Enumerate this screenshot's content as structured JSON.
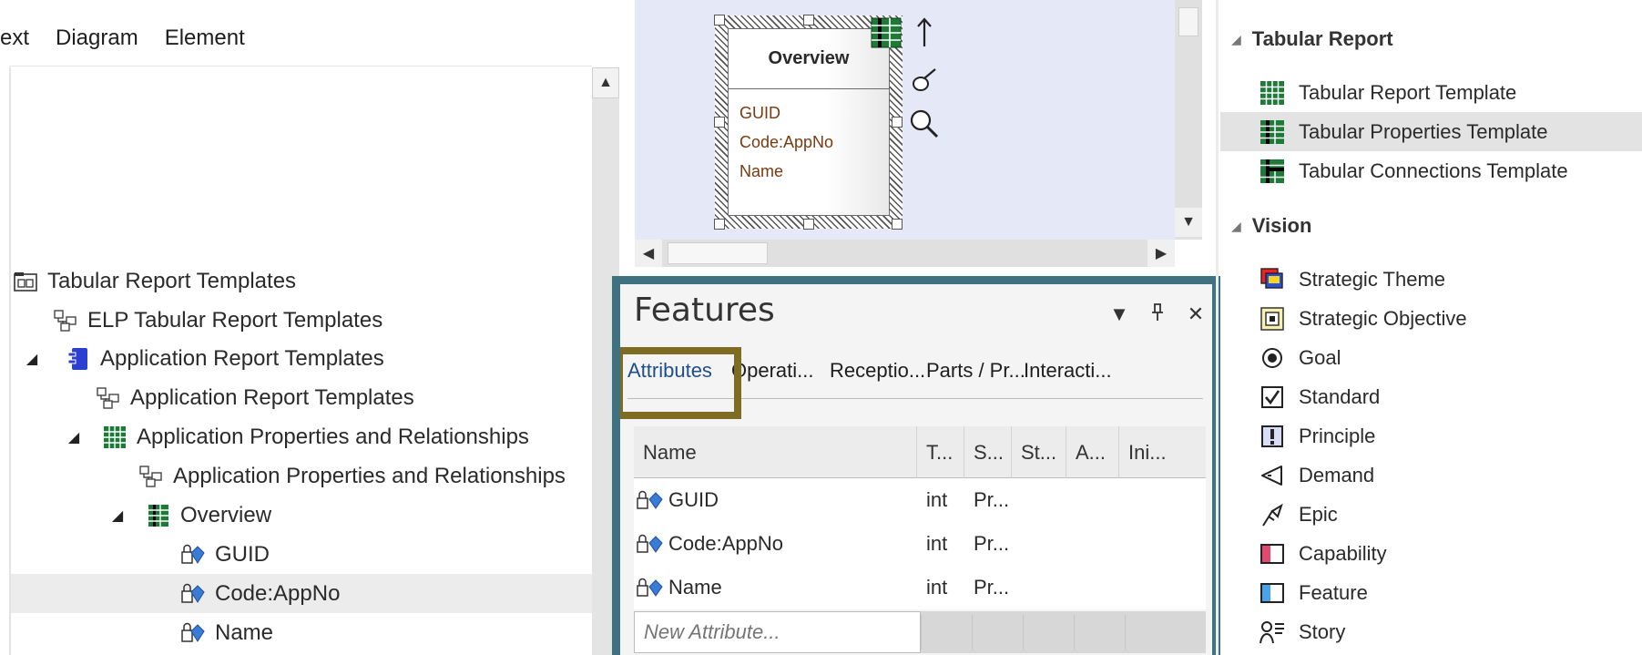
{
  "menubar": {
    "items": [
      "ext",
      "Diagram",
      "Element"
    ]
  },
  "tree": {
    "rows": [
      {
        "label": "Tabular Report Templates",
        "icon": "package-folder-icon",
        "expander": ""
      },
      {
        "label": "ELP Tabular Report Templates",
        "icon": "diagram-icon",
        "expander": ""
      },
      {
        "label": "Application Report Templates",
        "icon": "component-icon",
        "expander": "◢"
      },
      {
        "label": "Application Report Templates",
        "icon": "diagram-icon",
        "expander": ""
      },
      {
        "label": "Application Properties and Relationships",
        "icon": "table-grid-icon",
        "expander": "◢"
      },
      {
        "label": "Application Properties and Relationships",
        "icon": "diagram-icon",
        "expander": ""
      },
      {
        "label": "Overview",
        "icon": "properties-template-icon",
        "expander": "◢"
      },
      {
        "label": "GUID",
        "icon": "attribute-lock-icon",
        "expander": ""
      },
      {
        "label": "Code:AppNo",
        "icon": "attribute-lock-icon",
        "expander": "",
        "selected": true
      },
      {
        "label": "Name",
        "icon": "attribute-lock-icon",
        "expander": ""
      }
    ]
  },
  "diagram": {
    "element_name": "Overview",
    "attributes": [
      "GUID",
      "Code:AppNo",
      "Name"
    ]
  },
  "features": {
    "title": "Features",
    "controls": {
      "dropdown": "▼",
      "pin": "ᵖ",
      "close": "✕"
    },
    "tabs": [
      "Attributes",
      "Operati...",
      "Receptio...",
      "Parts / Pr...",
      "Interacti..."
    ],
    "active_tab": "Attributes",
    "columns": [
      "Name",
      "T...",
      "S...",
      "St...",
      "A...",
      "Ini..."
    ],
    "rows": [
      {
        "name": "GUID",
        "type": "int",
        "scope": "Pr..."
      },
      {
        "name": "Code:AppNo",
        "type": "int",
        "scope": "Pr..."
      },
      {
        "name": "Name",
        "type": "int",
        "scope": "Pr..."
      }
    ],
    "new_attribute_placeholder": "New Attribute..."
  },
  "toolbox": {
    "groups": [
      {
        "title": "Tabular Report",
        "items": [
          {
            "label": "Tabular Report Template",
            "icon": "table-grid-icon"
          },
          {
            "label": "Tabular Properties Template",
            "icon": "properties-template-icon",
            "selected": true
          },
          {
            "label": "Tabular Connections Template",
            "icon": "connections-template-icon"
          }
        ]
      },
      {
        "title": "Vision",
        "items": [
          {
            "label": "Strategic Theme",
            "icon": "strategic-theme-icon"
          },
          {
            "label": "Strategic Objective",
            "icon": "strategic-objective-icon"
          },
          {
            "label": "Goal",
            "icon": "goal-icon"
          },
          {
            "label": "Standard",
            "icon": "standard-checkbox-icon"
          },
          {
            "label": "Principle",
            "icon": "principle-icon"
          },
          {
            "label": "Demand",
            "icon": "demand-icon"
          },
          {
            "label": "Epic",
            "icon": "epic-icon"
          },
          {
            "label": "Capability",
            "icon": "capability-icon"
          },
          {
            "label": "Feature",
            "icon": "feature-icon"
          },
          {
            "label": "Story",
            "icon": "story-icon"
          }
        ]
      }
    ]
  },
  "colors": {
    "features_frame": "#3f7280",
    "tab_highlight": "#7d6c22",
    "diagram_background": "#e5e8f6",
    "attribute_text": "#7a3a10"
  }
}
